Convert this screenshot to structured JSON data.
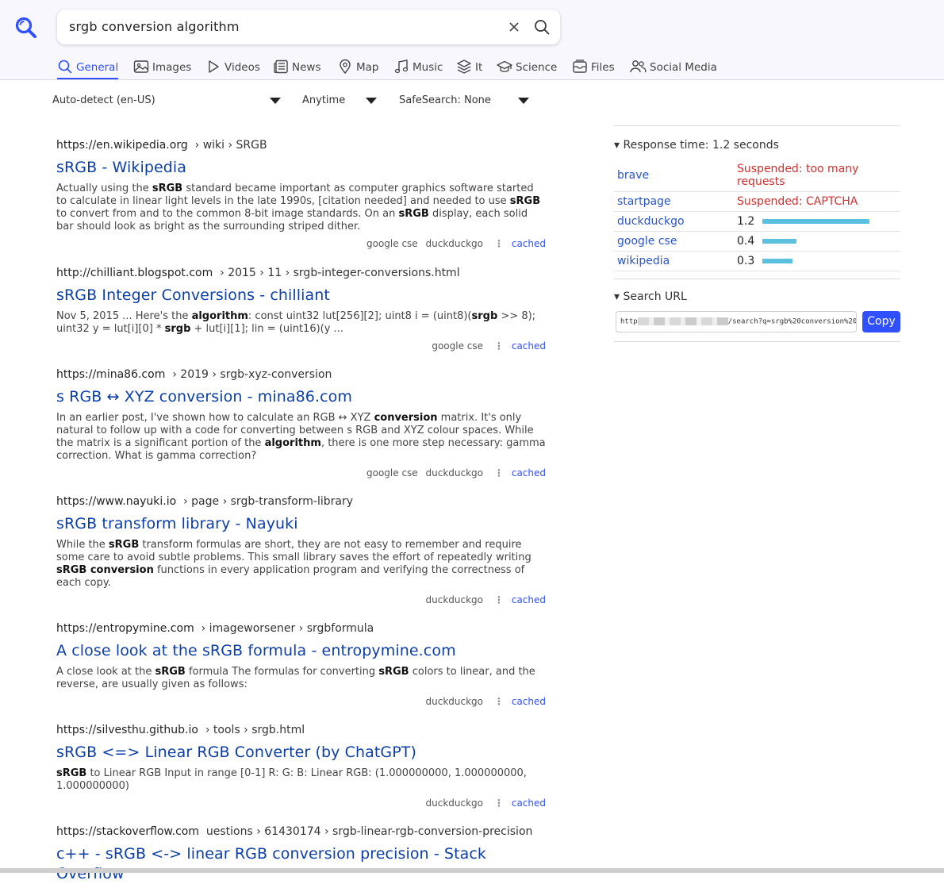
{
  "search": {
    "query": "srgb conversion algorithm"
  },
  "categories": [
    {
      "label": "General",
      "icon": "search-icon",
      "active": true
    },
    {
      "label": "Images",
      "icon": "image-icon"
    },
    {
      "label": "Videos",
      "icon": "play-icon"
    },
    {
      "label": "News",
      "icon": "newspaper-icon"
    },
    {
      "label": "Map",
      "icon": "map-pin-icon"
    },
    {
      "label": "Music",
      "icon": "music-icon"
    },
    {
      "label": "It",
      "icon": "layers-icon"
    },
    {
      "label": "Science",
      "icon": "graduation-cap-icon"
    },
    {
      "label": "Files",
      "icon": "archive-icon"
    },
    {
      "label": "Social Media",
      "icon": "people-icon"
    }
  ],
  "filters": {
    "language": "Auto-detect (en-US)",
    "time": "Anytime",
    "safesearch": "SafeSearch: None"
  },
  "results": [
    {
      "host": "https://en.wikipedia.org",
      "path": "› wiki › SRGB",
      "title": "sRGB - Wikipedia",
      "snippet_html": "Actually using the <b>sRGB</b> standard became important as computer graphics software started to calculate in linear light levels in the late 1990s, [citation needed] and needed to use <b>sRGB</b> to convert from and to the common 8-bit image standards. On an <b>sRGB</b> display, each solid bar should look as bright as the surrounding striped dither.",
      "engines": [
        "google cse",
        "duckduckgo"
      ],
      "cached": "cached"
    },
    {
      "host": "http://chilliant.blogspot.com",
      "path": "› 2015 › 11 › srgb-integer-conversions.html",
      "title": "sRGB Integer Conversions - chilliant",
      "snippet_html": "Nov 5, 2015 ... Here's the <b>algorithm</b>: const uint32 lut[256][2]; uint8 i = (uint8)(<b>srgb</b> &gt;&gt; 8); uint32 y = lut[i][0] * <b>srgb</b> + lut[i][1]; lin = (uint16)(y ...",
      "engines": [
        "google cse"
      ],
      "cached": "cached"
    },
    {
      "host": "https://mina86.com",
      "path": "› 2019 › srgb-xyz-conversion",
      "title": "s RGB ↔ XYZ conversion - mina86.com",
      "snippet_html": "In an earlier post, I've shown how to calculate an RGB ↔ XYZ <b>conversion</b> matrix. It's only natural to follow up with a code for converting between s RGB and XYZ colour spaces. While the matrix is a significant portion of the <b>algorithm</b>, there is one more step necessary: gamma correction. What is gamma correction?",
      "engines": [
        "google cse",
        "duckduckgo"
      ],
      "cached": "cached"
    },
    {
      "host": "https://www.nayuki.io",
      "path": "› page › srgb-transform-library",
      "title": "sRGB transform library - Nayuki",
      "snippet_html": "While the <b>sRGB</b> transform formulas are short, they are not easy to remember and require some care to avoid subtle problems. This small library saves the effort of repeatedly writing <b>sRGB conversion</b> functions in every application program and verifying the correctness of each copy.",
      "engines": [
        "duckduckgo"
      ],
      "cached": "cached"
    },
    {
      "host": "https://entropymine.com",
      "path": "› imageworsener › srgbformula",
      "title": "A close look at the sRGB formula - entropymine.com",
      "snippet_html": "A close look at the <b>sRGB</b> formula The formulas for converting <b>sRGB</b> colors to linear, and the reverse, are usually given as follows:",
      "engines": [
        "duckduckgo"
      ],
      "cached": "cached"
    },
    {
      "host": "https://silvesthu.github.io",
      "path": "› tools › srgb.html",
      "title": "sRGB <=> Linear RGB Converter (by ChatGPT)",
      "snippet_html": "<b>sRGB</b> to Linear RGB Input in range [0-1] R: G: B: Linear RGB: (1.000000000, 1.000000000, 1.000000000)",
      "engines": [
        "duckduckgo"
      ],
      "cached": "cached"
    },
    {
      "host": "https://stackoverflow.com",
      "path": "uestions › 61430174 › srgb-linear-rgb-conversion-precision",
      "title": "c++ - sRGB <-> linear RGB conversion precision - Stack Overflow",
      "snippet_html": "",
      "engines": [],
      "cached": ""
    }
  ],
  "sidebar": {
    "response_time": "Response time: 1.2 seconds",
    "engines": [
      {
        "name": "brave",
        "error": "Suspended: too many requests"
      },
      {
        "name": "startpage",
        "error": "Suspended: CAPTCHA"
      },
      {
        "name": "duckduckgo",
        "time": "1.2",
        "share": 1.0
      },
      {
        "name": "google cse",
        "time": "0.4",
        "share": 0.32
      },
      {
        "name": "wikipedia",
        "time": "0.3",
        "share": 0.28
      }
    ],
    "search_url_label": "Search URL",
    "search_url_prefix": "http",
    "search_url_suffix": "/search?q=srgb%20conversion%20a",
    "copy_label": "Copy"
  },
  "colors": {
    "accent": "#3050ff",
    "link": "#0c3ea8",
    "error": "#d03030",
    "bar": "#5bc0de"
  }
}
